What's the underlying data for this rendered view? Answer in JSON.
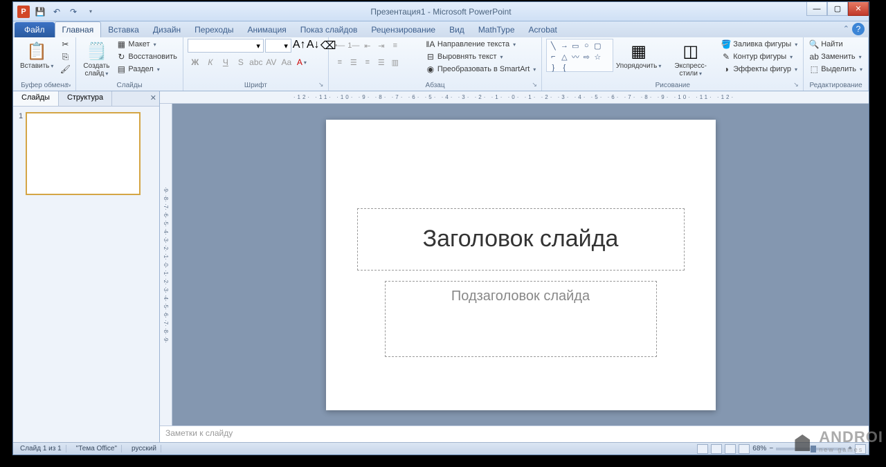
{
  "title": "Презентация1 - Microsoft PowerPoint",
  "file_tab": "Файл",
  "tabs": [
    "Главная",
    "Вставка",
    "Дизайн",
    "Переходы",
    "Анимация",
    "Показ слайдов",
    "Рецензирование",
    "Вид",
    "MathType",
    "Acrobat"
  ],
  "active_tab_index": 0,
  "ribbon": {
    "clipboard": {
      "label": "Буфер обмена",
      "paste": "Вставить"
    },
    "slides": {
      "label": "Слайды",
      "new_slide": "Создать\nслайд",
      "layout": "Макет",
      "reset": "Восстановить",
      "section": "Раздел"
    },
    "font": {
      "label": "Шрифт",
      "font_name": "",
      "font_size": ""
    },
    "paragraph": {
      "label": "Абзац",
      "text_direction": "Направление текста",
      "align_text": "Выровнять текст",
      "smartart": "Преобразовать в SmartArt"
    },
    "drawing": {
      "label": "Рисование",
      "arrange": "Упорядочить",
      "quick_styles": "Экспресс-стили",
      "shape_fill": "Заливка фигуры",
      "shape_outline": "Контур фигуры",
      "shape_effects": "Эффекты фигур"
    },
    "editing": {
      "label": "Редактирование",
      "find": "Найти",
      "replace": "Заменить",
      "select": "Выделить"
    }
  },
  "side": {
    "tab_slides": "Слайды",
    "tab_outline": "Структура",
    "slide_num": "1"
  },
  "slide": {
    "title_ph": "Заголовок слайда",
    "subtitle_ph": "Подзаголовок слайда"
  },
  "notes": "Заметки к слайду",
  "ruler_h": "·12·  ·11·  ·10·  ·9·  ·8·  ·7·  ·6·  ·5·  ·4·  ·3·  ·2·  ·1·  ·0·  ·1·  ·2·  ·3·  ·4·  ·5·  ·6·  ·7·  ·8·  ·9·  ·10·  ·11·  ·12·",
  "ruler_v": "·9· ·8· ·7· ·6· ·5· ·4· ·3· ·2· ·1· ·0· ·1· ·2· ·3· ·4· ·5· ·6· ·7· ·8· ·9·",
  "status": {
    "slide_info": "Слайд 1 из 1",
    "theme": "\"Тема Office\"",
    "language": "русский",
    "zoom": "68%"
  },
  "watermark": {
    "main": "ANDROI",
    "sub": "new games"
  }
}
